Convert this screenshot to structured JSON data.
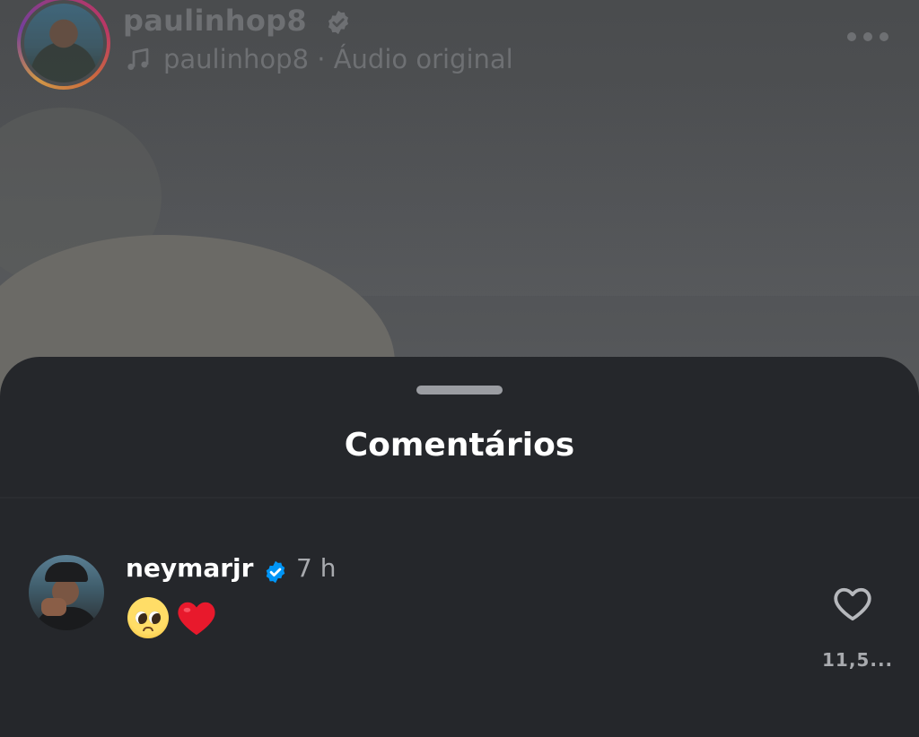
{
  "header": {
    "username": "paulinhop8",
    "audio_text": "paulinhop8 · Áudio original",
    "more_icon": "more-horizontal-icon",
    "music_icon": "music-note-icon",
    "verified_icon": "verified-badge-icon"
  },
  "sheet": {
    "title": "Comentários"
  },
  "comment": {
    "username": "neymarjr",
    "time": "7 h",
    "emoji_1": "pleading-face",
    "emoji_2": "red-heart",
    "like_count": "11,5...",
    "like_icon": "heart-outline-icon"
  },
  "colors": {
    "sheet_bg": "#25272b",
    "verified_blue": "#0095f6",
    "heart_red": "#e8192c",
    "muted_text": "#a8aaae"
  }
}
